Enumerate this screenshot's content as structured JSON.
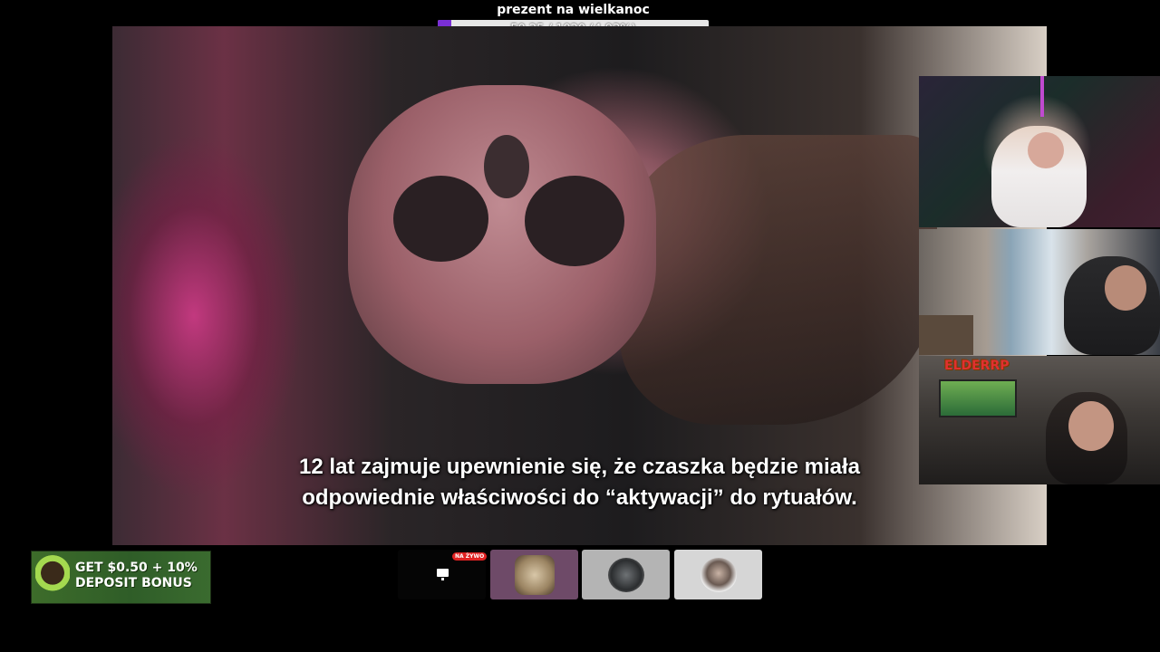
{
  "goal": {
    "title": "prezent na wielkanoc",
    "progress_text": "50.25 / 1020 (4.93%)",
    "current": 50.25,
    "target": 1020,
    "fraction": 0.0493,
    "fill_color": "#7a2fd6"
  },
  "video": {
    "subtitle_line1": "12 lat zajmuje upewnienie się, że czaszka będzie miała",
    "subtitle_line2": "odpowiednie właściwości do “aktywacji” do rytuałów."
  },
  "webcams": {
    "cam3_logo_a": "ELDER",
    "cam3_logo_b": "RP"
  },
  "ad": {
    "line1": "GET $0.50 + 10%",
    "line2": "DEPOSIT BONUS",
    "mascot_icon": "green-alien-mascot-icon"
  },
  "thumbnails": {
    "live_badge": "NA ŻYWO",
    "icons": [
      "monitor-icon",
      "avatar-face-icon",
      "car-icon",
      "avatar-person-icon"
    ]
  }
}
